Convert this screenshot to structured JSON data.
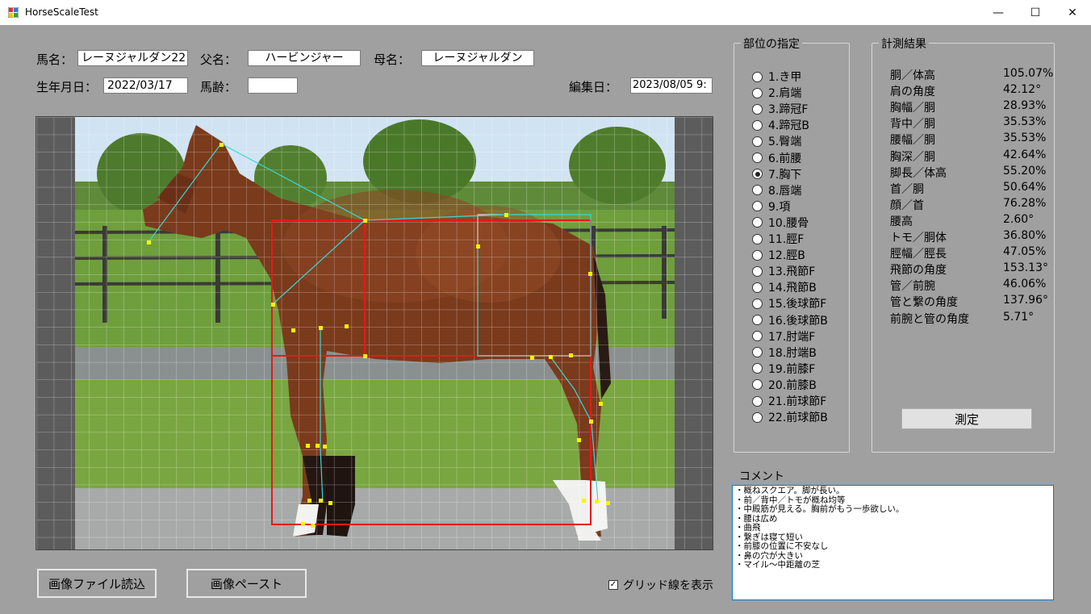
{
  "window": {
    "title": "HorseScaleTest",
    "minimize": "—",
    "maximize": "☐",
    "close": "✕"
  },
  "fields": {
    "horse_name_label": "馬名：",
    "horse_name": "レーヌジャルダン22",
    "sire_label": "父名：",
    "sire": "ハービンジャー",
    "dam_label": "母名：",
    "dam": "レーヌジャルダン",
    "birth_label": "生年月日：",
    "birth": "2022/03/17",
    "age_label": "馬齢：",
    "age": "",
    "edit_label": "編集日：",
    "edit_date": "2023/08/05 9:"
  },
  "parts": {
    "title": "部位の指定",
    "selected_index": 6,
    "items": [
      "1.き甲",
      "2.肩端",
      "3.蹄冠F",
      "4.蹄冠B",
      "5.臀端",
      "6.前腰",
      "7.胸下",
      "8.唇端",
      "9.項",
      "10.腰骨",
      "11.脛F",
      "12.脛B",
      "13.飛節F",
      "14.飛節B",
      "15.後球節F",
      "16.後球節B",
      "17.肘端F",
      "18.肘端B",
      "19.前膝F",
      "20.前膝B",
      "21.前球節F",
      "22.前球節B"
    ]
  },
  "results": {
    "title": "計測結果",
    "rows": [
      {
        "label": "胴／体高",
        "value": "105.07%"
      },
      {
        "label": "肩の角度",
        "value": "42.12°"
      },
      {
        "label": "胸幅／胴",
        "value": "28.93%"
      },
      {
        "label": "背中／胴",
        "value": "35.53%"
      },
      {
        "label": "腰幅／胴",
        "value": "35.53%"
      },
      {
        "label": "胸深／胴",
        "value": "42.64%"
      },
      {
        "label": "脚長／体高",
        "value": "55.20%"
      },
      {
        "label": "首／胴",
        "value": "50.64%"
      },
      {
        "label": "顔／首",
        "value": "76.28%"
      },
      {
        "label": "腰高",
        "value": "2.60°"
      },
      {
        "label": "トモ／胴体",
        "value": "36.80%"
      },
      {
        "label": "脛幅／脛長",
        "value": "47.05%"
      },
      {
        "label": "飛節の角度",
        "value": "153.13°"
      },
      {
        "label": "管／前腕",
        "value": "46.06%"
      },
      {
        "label": "管と繋の角度",
        "value": "137.96°"
      },
      {
        "label": "前腕と管の角度",
        "value": "5.71°"
      }
    ],
    "measure_button": "測定"
  },
  "comment": {
    "title": "コメント",
    "lines": [
      "・概ねスクエア。脚が長い。",
      "・前／背中／トモが概ね均等",
      "・中殿筋が見える。胸前がもう一歩欲しい。",
      "・腰は広め",
      "・曲飛",
      "・繋ぎは寝て短い",
      "・前膝の位置に不安なし",
      "・鼻の穴が大きい",
      "・マイル～中距離の芝"
    ]
  },
  "bottom": {
    "load_button": "画像ファイル読込",
    "paste_button": "画像ペースト",
    "grid_checkbox": "グリッド線を表示",
    "grid_checked": true,
    "check_mark": "✓"
  },
  "colors": {
    "accent_red": "#e41a1a",
    "accent_cyan": "#3ad7d7",
    "accent_yellow": "#f5f500",
    "input_focus": "#0078d7"
  }
}
